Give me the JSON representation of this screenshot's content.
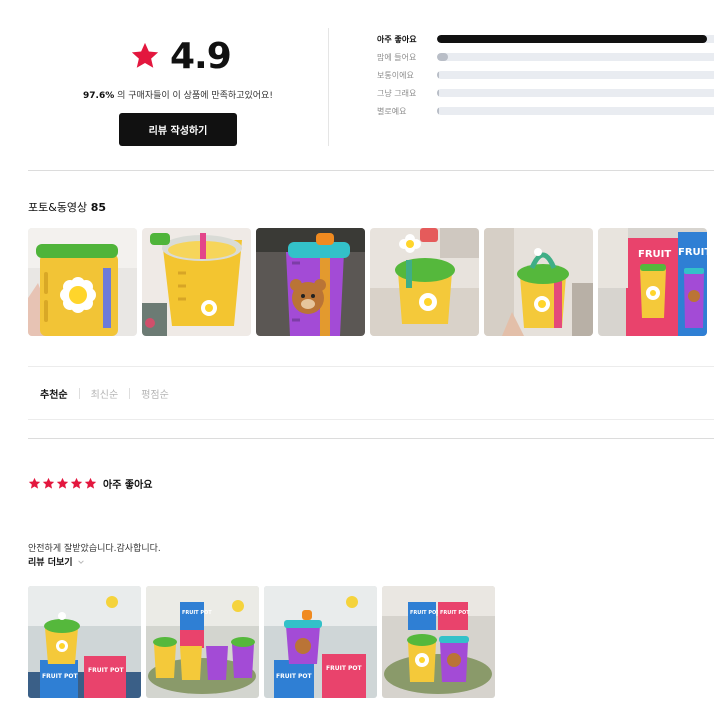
{
  "summary": {
    "score": "4.9",
    "satisfaction_pct": "97.6%",
    "satisfaction_text": " 의 구매자들이 이 상품에 만족하고있어요!",
    "write_review_label": "리뷰 작성하기",
    "star_color": "#e3173e"
  },
  "distribution": [
    {
      "label": "아주 좋아요",
      "fraction": 0.976,
      "color": "#111111",
      "top": true
    },
    {
      "label": "맘에 들어요",
      "fraction": 0.04,
      "color": "#b9bec7",
      "top": false
    },
    {
      "label": "보통이에요",
      "fraction": 0.005,
      "color": "#b9bec7",
      "top": false
    },
    {
      "label": "그냥 그래요",
      "fraction": 0.005,
      "color": "#b9bec7",
      "top": false
    },
    {
      "label": "별로예요",
      "fraction": 0.005,
      "color": "#b9bec7",
      "top": false
    }
  ],
  "photos": {
    "title": "포토&동영상 ",
    "count": "85"
  },
  "sort_options": [
    {
      "label": "추천순",
      "active": true
    },
    {
      "label": "최신순",
      "active": false
    },
    {
      "label": "평점순",
      "active": false
    }
  ],
  "review": {
    "stars": 5,
    "rating_label": "아주 좋아요",
    "text": "안전하게 잘받았습니다.감사합니다.",
    "more_label": "리뷰 더보기"
  }
}
